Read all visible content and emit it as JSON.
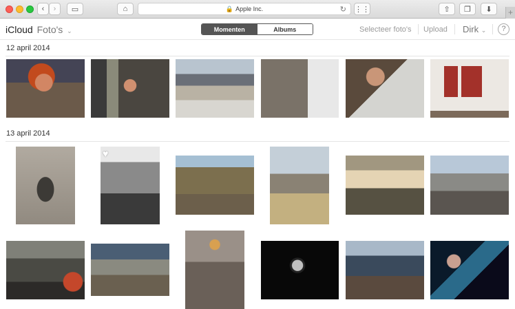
{
  "browser": {
    "address": "Apple Inc."
  },
  "header": {
    "brand": "iCloud",
    "app": "Foto's",
    "segments": [
      "Momenten",
      "Albums"
    ],
    "select_label": "Selecteer foto's",
    "upload_label": "Upload",
    "user": "Dirk",
    "help": "?"
  },
  "sections": [
    {
      "date": "12 april 2014"
    },
    {
      "date": "13 april 2014"
    }
  ],
  "colors": {
    "segment_active": "#555555",
    "lock_green": "#2faa3f"
  }
}
